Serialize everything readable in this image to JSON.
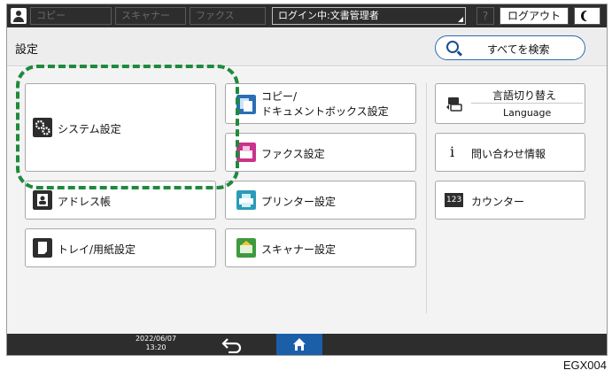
{
  "topbar": {
    "tabs": [
      "コピー",
      "スキャナー",
      "ファクス"
    ],
    "login_status": "ログイン中:文書管理者",
    "help_label": "?",
    "logout_label": "ログアウト"
  },
  "header": {
    "title": "設定",
    "search_label": "すべてを検索"
  },
  "tiles": {
    "system": "システム設定",
    "address": "アドレス帳",
    "tray": "トレイ/用紙設定",
    "copy_line1": "コピー/",
    "copy_line2": "ドキュメントボックス設定",
    "fax": "ファクス設定",
    "printer": "プリンター設定",
    "scanner": "スキャナー設定",
    "language_line1": "言語切り替え",
    "language_line2": "Language",
    "inquiry": "問い合わせ情報",
    "counter": "カウンター",
    "counter_icon_text": "123",
    "info_icon_text": "i"
  },
  "statusbar": {
    "date": "2022/06/07",
    "time": "13:20"
  },
  "figure_code": "EGX004",
  "colors": {
    "highlight": "#1e8a3c",
    "home_button": "#1b5fa8",
    "bars": "#2d2d2d"
  }
}
